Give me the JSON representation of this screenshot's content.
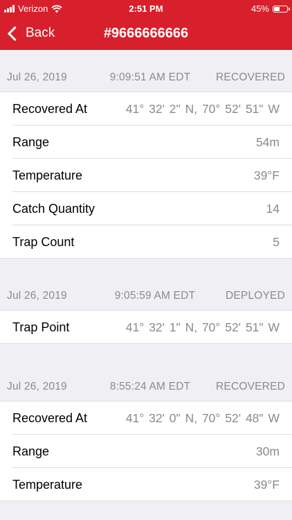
{
  "status_bar": {
    "carrier": "Verizon",
    "time": "2:51 PM",
    "battery": "45%",
    "battery_level": 0.45
  },
  "nav": {
    "back_label": "Back",
    "title": "#9666666666"
  },
  "sections": [
    {
      "date": "Jul 26, 2019",
      "time": "9:09:51 AM EDT",
      "status": "RECOVERED",
      "rows": [
        {
          "label": "Recovered At",
          "value": "41° 32'  2\" N,  70° 52' 51\" W"
        },
        {
          "label": "Range",
          "value": "54m"
        },
        {
          "label": "Temperature",
          "value": "39°F"
        },
        {
          "label": "Catch Quantity",
          "value": "14"
        },
        {
          "label": "Trap Count",
          "value": "5"
        }
      ]
    },
    {
      "date": "Jul 26, 2019",
      "time": "9:05:59 AM EDT",
      "status": "DEPLOYED",
      "rows": [
        {
          "label": "Trap Point",
          "value": "41° 32'  1\" N,  70° 52' 51\" W"
        }
      ]
    },
    {
      "date": "Jul 26, 2019",
      "time": "8:55:24 AM EDT",
      "status": "RECOVERED",
      "rows": [
        {
          "label": "Recovered At",
          "value": "41° 32'  0\" N,  70° 52' 48\" W"
        },
        {
          "label": "Range",
          "value": "30m"
        },
        {
          "label": "Temperature",
          "value": "39°F"
        }
      ]
    }
  ]
}
